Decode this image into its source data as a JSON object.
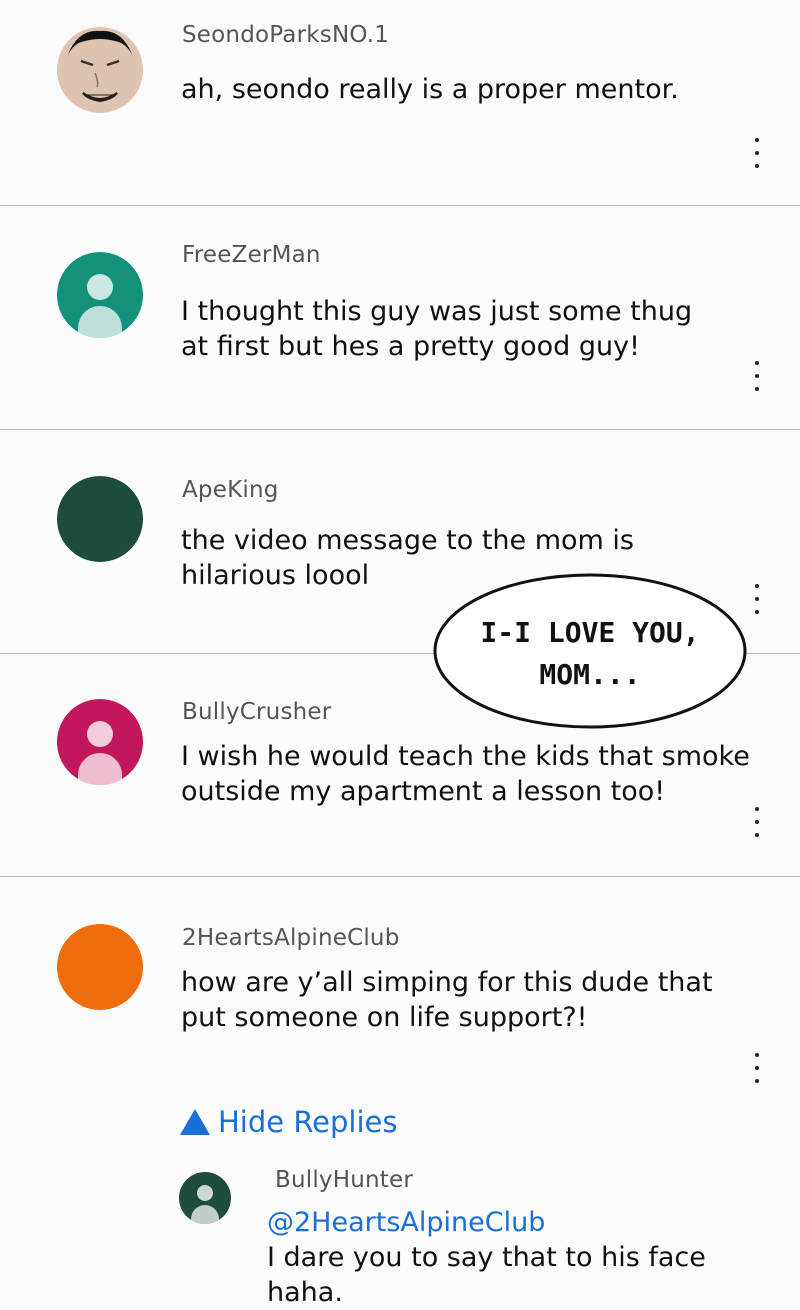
{
  "comments": [
    {
      "username": "SeondoParksNO.1",
      "text": "ah, seondo really is a proper mentor.",
      "avatar": "custom-face"
    },
    {
      "username": "FreeZerMan",
      "text": "I thought this guy was just some thug at first but hes a pretty good guy!",
      "avatar_color": "#14917a"
    },
    {
      "username": "ApeKing",
      "text": "the video message to the mom is hilarious loool",
      "avatar_color": "#1e4d3a"
    },
    {
      "username": "BullyCrusher",
      "text": "I wish he would teach the kids that smoke outside my apartment a lesson too!",
      "avatar_color": "#c2185b"
    },
    {
      "username": "2HeartsAlpineClub",
      "text": "how are y’all simping for this dude that put someone on life support?!",
      "avatar_color": "#ee6c0c"
    }
  ],
  "replies_toggle": {
    "label": "Hide Replies",
    "icon": "triangle-up-icon",
    "color": "#1a6fd6"
  },
  "reply": {
    "username": "BullyHunter",
    "mention": "@2HeartsAlpineClub",
    "text": "I dare you to say that to his face haha.",
    "avatar_color": "#1e4d3a"
  },
  "speech_bubble": {
    "line1": "I-I LOVE YOU,",
    "line2": "MOM..."
  }
}
